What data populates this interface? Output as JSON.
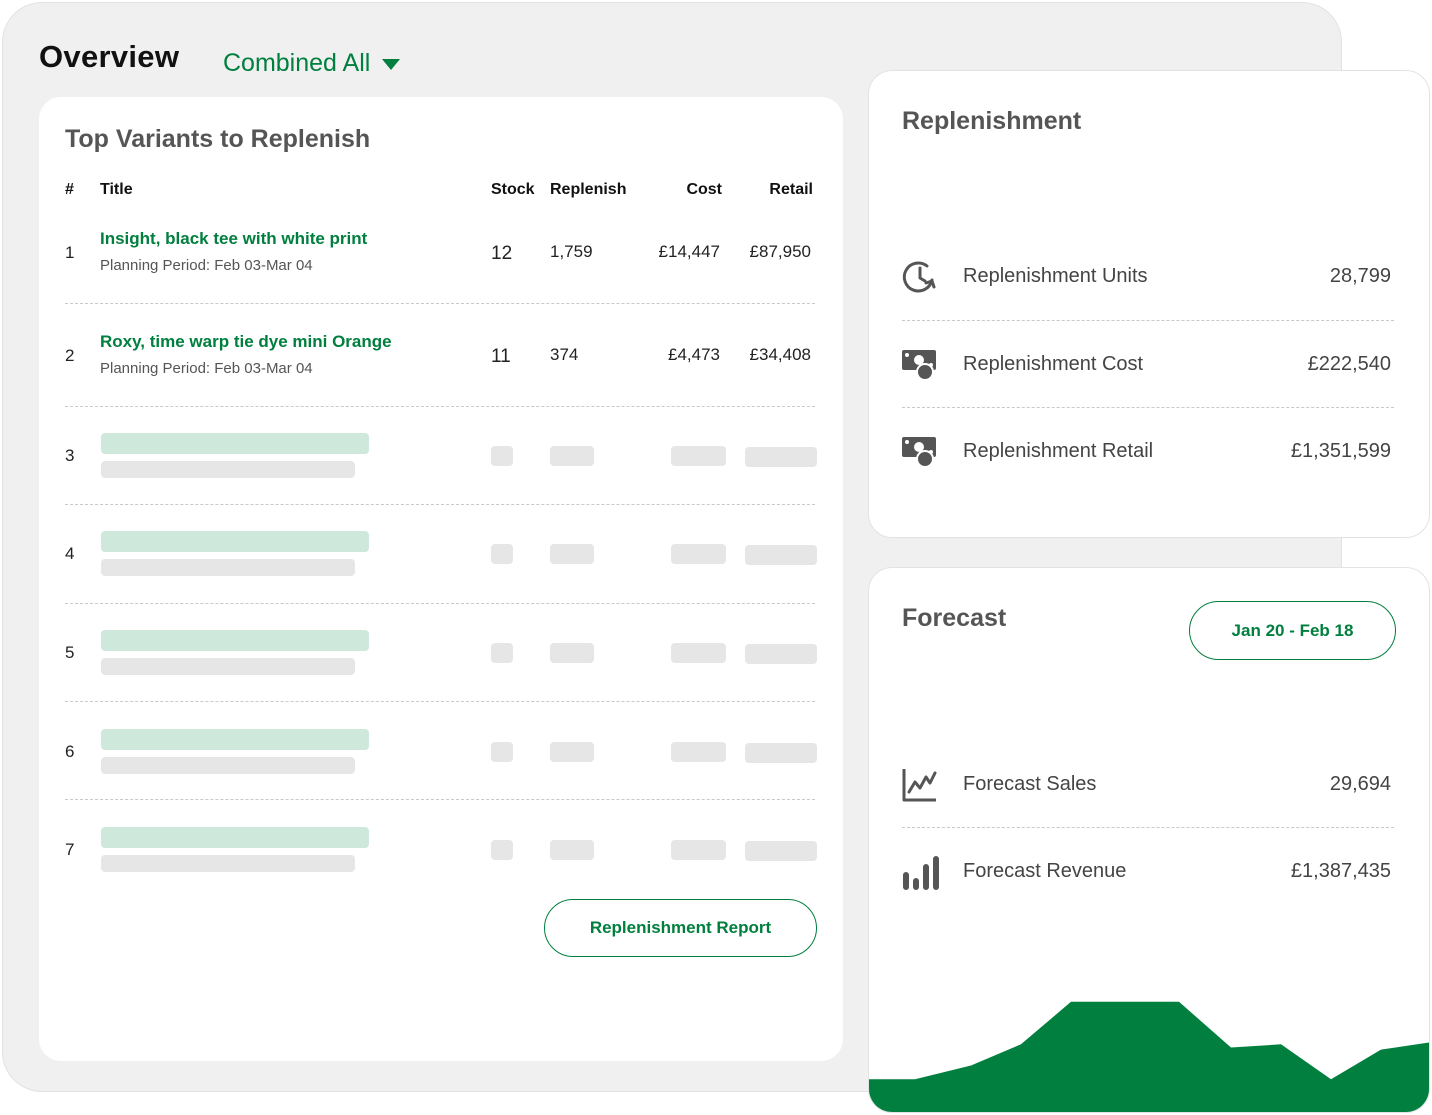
{
  "header": {
    "title": "Overview",
    "store_selector": "Combined All"
  },
  "top_variants": {
    "title": "Top Variants to Replenish",
    "columns": {
      "num": "#",
      "title": "Title",
      "stock": "Stock",
      "replenish": "Replenish",
      "cost": "Cost",
      "retail": "Retail"
    },
    "rows": [
      {
        "num": "1",
        "title": "Insight, black tee with white print",
        "period": "Planning Period: Feb 03-Mar 04",
        "stock": "12",
        "replenish": "1,759",
        "cost": "£14,447",
        "retail": "£87,950"
      },
      {
        "num": "2",
        "title": "Roxy, time warp tie dye mini Orange",
        "period": "Planning Period: Feb 03-Mar 04",
        "stock": "11",
        "replenish": "374",
        "cost": "£4,473",
        "retail": "£34,408"
      }
    ],
    "placeholder_rows": [
      "3",
      "4",
      "5",
      "6",
      "7"
    ],
    "report_button": "Replenishment Report"
  },
  "replenishment": {
    "title": "Replenishment",
    "metrics": [
      {
        "label": "Replenishment Units",
        "value": "28,799",
        "icon": "clock-refresh-icon"
      },
      {
        "label": "Replenishment Cost",
        "value": "£222,540",
        "icon": "cash-icon"
      },
      {
        "label": "Replenishment Retail",
        "value": "£1,351,599",
        "icon": "cash-icon"
      }
    ]
  },
  "forecast": {
    "title": "Forecast",
    "date_range": "Jan 20 - Feb 18",
    "metrics": [
      {
        "label": "Forecast Sales",
        "value": "29,694",
        "icon": "line-chart-icon"
      },
      {
        "label": "Forecast Revenue",
        "value": "£1,387,435",
        "icon": "bar-chart-icon"
      }
    ],
    "trend": [
      0.27,
      0.27,
      0.4,
      0.6,
      1.0,
      1.0,
      0.57,
      0.6,
      0.27,
      0.55,
      0.62
    ]
  },
  "colors": {
    "accent": "#007f3e",
    "skeleton_green": "#cfe8dc",
    "skeleton_gray": "#e6e6e6"
  }
}
